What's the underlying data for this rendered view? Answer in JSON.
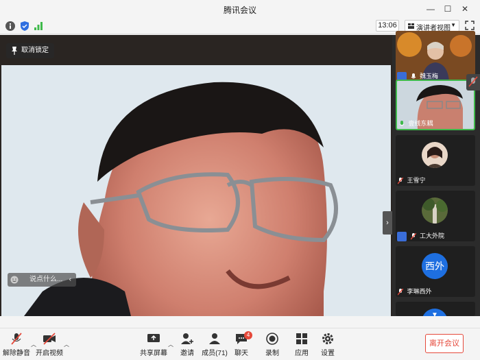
{
  "window": {
    "title": "腾讯会议",
    "controls": {
      "minimize": "—",
      "maximize": "☐",
      "close": "✕"
    }
  },
  "toolbar": {
    "icons": [
      "info-icon",
      "shield-icon",
      "signal-icon"
    ],
    "time": "13:06",
    "view_mode": "演讲者视图",
    "colors": {
      "shield": "#2f6fe0",
      "signal": "#3fba4b"
    }
  },
  "main_video": {
    "unlock_label": "取消锁定",
    "chat_placeholder": "说点什么...",
    "collapse_arrow": "›"
  },
  "participants": [
    {
      "name": "魏玉梅",
      "has_person_badge": true,
      "mic": "active",
      "type": "video"
    },
    {
      "name": "壹线东耦",
      "mic": "speaking",
      "type": "video",
      "active": true
    },
    {
      "name": "王雪宁",
      "mic": "muted",
      "type": "avatar-photo"
    },
    {
      "name": "工大外院",
      "has_person_badge": true,
      "mic": "muted",
      "type": "avatar-photo"
    },
    {
      "name": "李琳西外",
      "mic": "muted",
      "type": "avatar-text",
      "avatar_text": "西外"
    },
    {
      "name": "",
      "type": "avatar-partial"
    }
  ],
  "bottombar": {
    "unmute": "解除静音",
    "start_video": "开启视频",
    "share_screen": "共享屏幕",
    "invite": "邀请",
    "members": "成员(71)",
    "chat": "聊天",
    "chat_badge": "4",
    "record": "录制",
    "apps": "应用",
    "settings": "设置",
    "leave": "离开会议"
  },
  "colors": {
    "accent_green": "#3fba4b",
    "leave_red": "#e5483a",
    "avatar_blue": "#1e6fe0"
  }
}
